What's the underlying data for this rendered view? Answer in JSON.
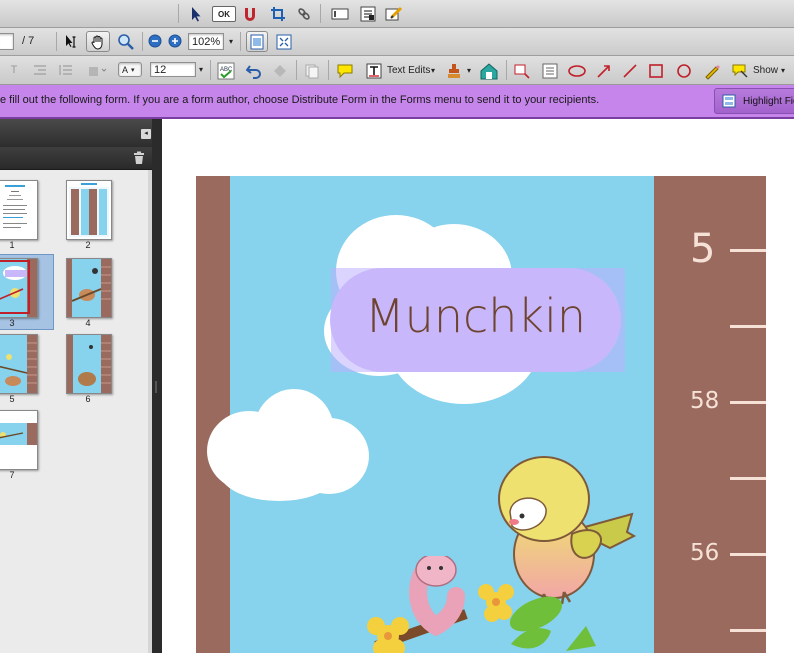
{
  "toolbar_top": {
    "icons": [
      "select-arrow-icon",
      "ok-button-icon",
      "magnet-icon",
      "crop-icon",
      "link-icon",
      "text-field-icon",
      "list-box-icon",
      "edit-icon"
    ],
    "ok_label": "OK"
  },
  "toolbar_nav": {
    "page_current": "",
    "page_total": "/ 7",
    "zoom": "102%"
  },
  "toolbar_comment": {
    "font_size_label": "A",
    "font_size": "12",
    "text_edits_label": "Text Edits",
    "show_label": "Show"
  },
  "form_bar": {
    "message": "e fill out the following form. If you are a form author, choose Distribute Form in the Forms menu to send it to your recipients.",
    "highlight_button": "Highlight Fiel"
  },
  "page_thumbnails": [
    {
      "label": "1",
      "selected": false
    },
    {
      "label": "2",
      "selected": false
    },
    {
      "label": "3",
      "selected": true
    },
    {
      "label": "4",
      "selected": false
    },
    {
      "label": "5",
      "selected": false
    },
    {
      "label": "6",
      "selected": false
    },
    {
      "label": "7",
      "selected": false
    }
  ],
  "document": {
    "name_field_value": "Munchkin",
    "ruler_labels": [
      "5",
      "58",
      "56"
    ]
  },
  "colors": {
    "form_bar": "#c585ea",
    "sky": "#87d2ec",
    "tree": "#9a6a5e",
    "name_field_bg": "#c8b8fb",
    "name_text": "#6e4430",
    "bird": "#eee16f"
  }
}
